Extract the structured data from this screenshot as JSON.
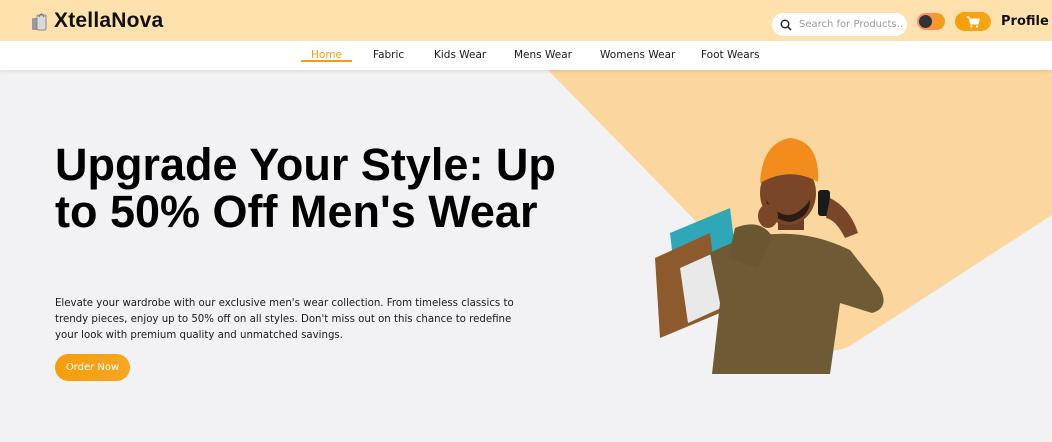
{
  "header": {
    "brand": "XtellaNova",
    "logo_icon": "shopping-bags-icon",
    "search_placeholder": "Search for Products...",
    "search_icon": "search-icon",
    "theme_toggle_icon": "toggle-icon",
    "cart_icon": "cart-icon",
    "profile_label": "Profile"
  },
  "nav": {
    "items": [
      {
        "label": "Home",
        "active": true
      },
      {
        "label": "Fabric",
        "active": false
      },
      {
        "label": "Kids Wear",
        "active": false
      },
      {
        "label": "Mens Wear",
        "active": false
      },
      {
        "label": "Womens Wear",
        "active": false
      },
      {
        "label": "Foot Wears",
        "active": false
      }
    ]
  },
  "hero": {
    "title": "Upgrade Your Style: Up to 50% Off Men's Wear",
    "description": "Elevate your wardrobe with our exclusive men's wear collection. From timeless classics to trendy pieces, enjoy up to 50% off on all styles. Don't miss out on this chance to redefine your look with premium quality and unmatched savings.",
    "cta_label": "Order Now"
  },
  "colors": {
    "accent": "#f59e0b",
    "header_bg": "#fee1ad",
    "hero_bg": "#f2f2f4",
    "hero_shape": "#fbd79f"
  }
}
